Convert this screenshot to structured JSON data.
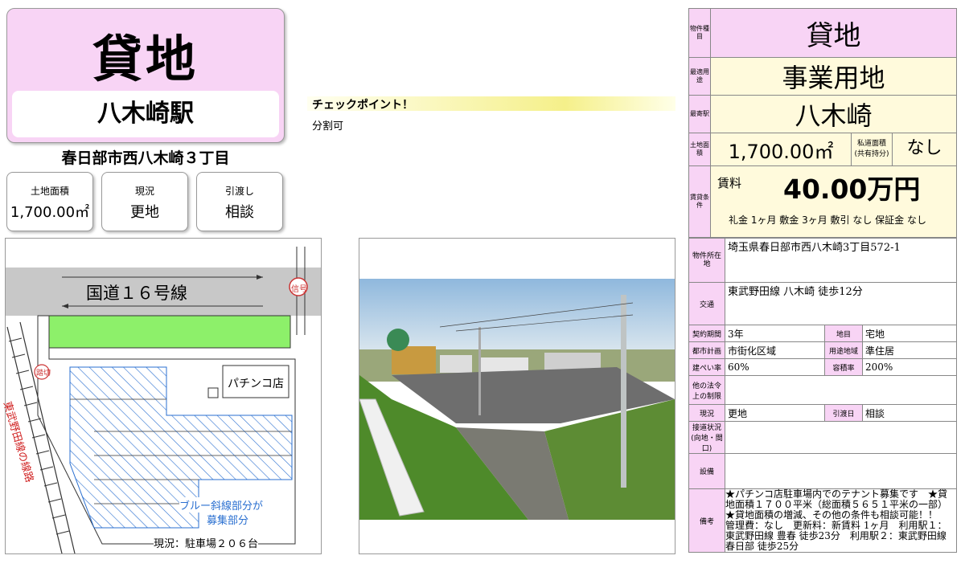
{
  "header": {
    "title": "貸地",
    "station": "八木崎駅",
    "address": "春日部市西八木崎３丁目"
  },
  "stats": [
    {
      "label": "土地面積",
      "value": "1,700.00㎡"
    },
    {
      "label": "現況",
      "value": "更地"
    },
    {
      "label": "引渡し",
      "value": "相談"
    }
  ],
  "checkpoint": {
    "label": "チェックポイント！",
    "text": "分割可"
  },
  "map": {
    "road": "国道１６号線",
    "signal": "信号",
    "crossing": "踏切",
    "railway": "東武野田線の線路",
    "shop": "パチンコ店",
    "note_line1": "ブルー斜線部分が",
    "note_line2": "募集部分",
    "status": "現況：駐車場２０６台"
  },
  "summary": {
    "type_label": "物件種目",
    "type_value": "貸地",
    "use_label": "最適用途",
    "use_value": "事業用地",
    "station_label": "最寄駅",
    "station_value": "八木崎",
    "area_label": "土地面積",
    "area_value": "1,700.00㎡",
    "private_road_label1": "私道面積",
    "private_road_label2": "(共有持分)",
    "private_road_value": "なし",
    "rent_label": "賃貸条件",
    "rent_word": "賃料",
    "rent_value": "40.00万円",
    "rent_terms": "礼金 1ヶ月  敷金 3ヶ月  敷引 なし  保証金 なし"
  },
  "details": {
    "location_label": "物件所在地",
    "location_value": "埼玉県春日部市西八木崎3丁目572-1",
    "transport_label": "交通",
    "transport_value": "東武野田線 八木崎 徒歩12分",
    "contract_label": "契約期間",
    "contract_value": "3年",
    "land_cat_label": "地目",
    "land_cat_value": "宅地",
    "city_plan_label": "都市計画",
    "city_plan_value": "市街化区域",
    "zoning_label": "用途地域",
    "zoning_value": "準住居",
    "bcr_label": "建ぺい率",
    "bcr_value": "60%",
    "far_label": "容積率",
    "far_value": "200%",
    "other_label1": "他の法令",
    "other_label2": "上の制限",
    "status_label": "現況",
    "status_value": "更地",
    "delivery_label": "引渡日",
    "delivery_value": "相談",
    "road_label1": "接道状況",
    "road_label2": "(向地・間口)",
    "facility_label": "設備",
    "remarks_label": "備考",
    "remarks": "★パチンコ店駐車場内でのテナント募集です　★貸地面積１７００平米（総面積５６５１平米の一部）★貸地面積の増減、その他の条件も相談可能！！　管理費：なし　更新料：新賃料 1ヶ月　利用駅１：東武野田線 豊春 徒歩23分　利用駅２：東武野田線 春日部 徒歩25分"
  }
}
